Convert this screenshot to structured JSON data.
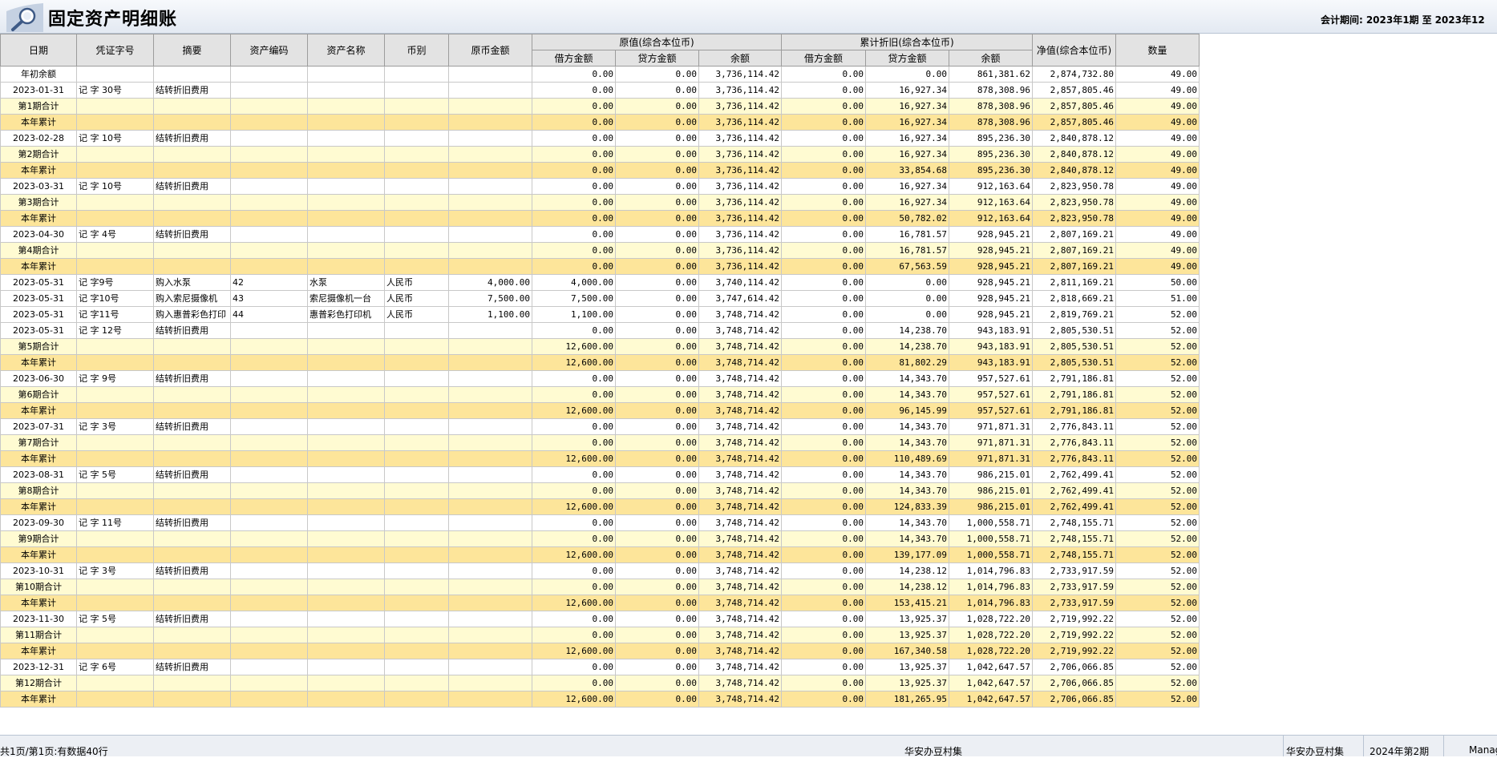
{
  "window": {
    "title": "固定资产明细账",
    "period_label": "会计期间:",
    "period_from": "2023年1期",
    "period_to_label": "至",
    "period_to": "2023年12"
  },
  "table": {
    "headers": {
      "date": "日期",
      "voucher": "凭证字号",
      "summary": "摘要",
      "asset_code": "资产编码",
      "asset_name": "资产名称",
      "currency": "币别",
      "orig_amount": "原币金额",
      "orig_value_group": "原值(综合本位币)",
      "accum_dep_group": "累计折旧(综合本位币)",
      "debit": "借方金额",
      "credit": "贷方金额",
      "balance": "余额",
      "net_value": "净值(综合本位币)",
      "quantity": "数量"
    },
    "rows": [
      {
        "type": "o",
        "date": "年初余额",
        "voucher": "",
        "summary": "",
        "code": "",
        "name": "",
        "cur": "",
        "amt": "",
        "od": "0.00",
        "oc": "0.00",
        "ob": "3,736,114.42",
        "dd": "0.00",
        "dc": "0.00",
        "db": "861,381.62",
        "nv": "2,874,732.80",
        "qty": "49.00"
      },
      {
        "type": "d",
        "date": "2023-01-31",
        "voucher": "记 字 30号",
        "summary": "结转折旧费用",
        "code": "",
        "name": "",
        "cur": "",
        "amt": "",
        "od": "0.00",
        "oc": "0.00",
        "ob": "3,736,114.42",
        "dd": "0.00",
        "dc": "16,927.34",
        "db": "878,308.96",
        "nv": "2,857,805.46",
        "qty": "49.00"
      },
      {
        "type": "s",
        "date": "第1期合计",
        "voucher": "",
        "summary": "",
        "code": "",
        "name": "",
        "cur": "",
        "amt": "",
        "od": "0.00",
        "oc": "0.00",
        "ob": "3,736,114.42",
        "dd": "0.00",
        "dc": "16,927.34",
        "db": "878,308.96",
        "nv": "2,857,805.46",
        "qty": "49.00"
      },
      {
        "type": "y",
        "date": "本年累计",
        "voucher": "",
        "summary": "",
        "code": "",
        "name": "",
        "cur": "",
        "amt": "",
        "od": "0.00",
        "oc": "0.00",
        "ob": "3,736,114.42",
        "dd": "0.00",
        "dc": "16,927.34",
        "db": "878,308.96",
        "nv": "2,857,805.46",
        "qty": "49.00"
      },
      {
        "type": "d",
        "date": "2023-02-28",
        "voucher": "记 字 10号",
        "summary": "结转折旧费用",
        "code": "",
        "name": "",
        "cur": "",
        "amt": "",
        "od": "0.00",
        "oc": "0.00",
        "ob": "3,736,114.42",
        "dd": "0.00",
        "dc": "16,927.34",
        "db": "895,236.30",
        "nv": "2,840,878.12",
        "qty": "49.00"
      },
      {
        "type": "s",
        "date": "第2期合计",
        "voucher": "",
        "summary": "",
        "code": "",
        "name": "",
        "cur": "",
        "amt": "",
        "od": "0.00",
        "oc": "0.00",
        "ob": "3,736,114.42",
        "dd": "0.00",
        "dc": "16,927.34",
        "db": "895,236.30",
        "nv": "2,840,878.12",
        "qty": "49.00"
      },
      {
        "type": "y",
        "date": "本年累计",
        "voucher": "",
        "summary": "",
        "code": "",
        "name": "",
        "cur": "",
        "amt": "",
        "od": "0.00",
        "oc": "0.00",
        "ob": "3,736,114.42",
        "dd": "0.00",
        "dc": "33,854.68",
        "db": "895,236.30",
        "nv": "2,840,878.12",
        "qty": "49.00"
      },
      {
        "type": "d",
        "date": "2023-03-31",
        "voucher": "记 字 10号",
        "summary": "结转折旧费用",
        "code": "",
        "name": "",
        "cur": "",
        "amt": "",
        "od": "0.00",
        "oc": "0.00",
        "ob": "3,736,114.42",
        "dd": "0.00",
        "dc": "16,927.34",
        "db": "912,163.64",
        "nv": "2,823,950.78",
        "qty": "49.00"
      },
      {
        "type": "s",
        "date": "第3期合计",
        "voucher": "",
        "summary": "",
        "code": "",
        "name": "",
        "cur": "",
        "amt": "",
        "od": "0.00",
        "oc": "0.00",
        "ob": "3,736,114.42",
        "dd": "0.00",
        "dc": "16,927.34",
        "db": "912,163.64",
        "nv": "2,823,950.78",
        "qty": "49.00"
      },
      {
        "type": "y",
        "date": "本年累计",
        "voucher": "",
        "summary": "",
        "code": "",
        "name": "",
        "cur": "",
        "amt": "",
        "od": "0.00",
        "oc": "0.00",
        "ob": "3,736,114.42",
        "dd": "0.00",
        "dc": "50,782.02",
        "db": "912,163.64",
        "nv": "2,823,950.78",
        "qty": "49.00"
      },
      {
        "type": "d",
        "date": "2023-04-30",
        "voucher": "记 字 4号",
        "summary": "结转折旧费用",
        "code": "",
        "name": "",
        "cur": "",
        "amt": "",
        "od": "0.00",
        "oc": "0.00",
        "ob": "3,736,114.42",
        "dd": "0.00",
        "dc": "16,781.57",
        "db": "928,945.21",
        "nv": "2,807,169.21",
        "qty": "49.00"
      },
      {
        "type": "s",
        "date": "第4期合计",
        "voucher": "",
        "summary": "",
        "code": "",
        "name": "",
        "cur": "",
        "amt": "",
        "od": "0.00",
        "oc": "0.00",
        "ob": "3,736,114.42",
        "dd": "0.00",
        "dc": "16,781.57",
        "db": "928,945.21",
        "nv": "2,807,169.21",
        "qty": "49.00"
      },
      {
        "type": "y",
        "date": "本年累计",
        "voucher": "",
        "summary": "",
        "code": "",
        "name": "",
        "cur": "",
        "amt": "",
        "od": "0.00",
        "oc": "0.00",
        "ob": "3,736,114.42",
        "dd": "0.00",
        "dc": "67,563.59",
        "db": "928,945.21",
        "nv": "2,807,169.21",
        "qty": "49.00"
      },
      {
        "type": "d",
        "date": "2023-05-31",
        "voucher": "记 字9号",
        "summary": "购入水泵",
        "code": "42",
        "name": "水泵",
        "cur": "人民币",
        "amt": "4,000.00",
        "od": "4,000.00",
        "oc": "0.00",
        "ob": "3,740,114.42",
        "dd": "0.00",
        "dc": "0.00",
        "db": "928,945.21",
        "nv": "2,811,169.21",
        "qty": "50.00"
      },
      {
        "type": "d",
        "date": "2023-05-31",
        "voucher": "记 字10号",
        "summary": "购入索尼摄像机",
        "code": "43",
        "name": "索尼摄像机一台",
        "cur": "人民币",
        "amt": "7,500.00",
        "od": "7,500.00",
        "oc": "0.00",
        "ob": "3,747,614.42",
        "dd": "0.00",
        "dc": "0.00",
        "db": "928,945.21",
        "nv": "2,818,669.21",
        "qty": "51.00"
      },
      {
        "type": "d",
        "date": "2023-05-31",
        "voucher": "记 字11号",
        "summary": "购入惠普彩色打印",
        "code": "44",
        "name": "惠普彩色打印机",
        "cur": "人民币",
        "amt": "1,100.00",
        "od": "1,100.00",
        "oc": "0.00",
        "ob": "3,748,714.42",
        "dd": "0.00",
        "dc": "0.00",
        "db": "928,945.21",
        "nv": "2,819,769.21",
        "qty": "52.00"
      },
      {
        "type": "d",
        "date": "2023-05-31",
        "voucher": "记 字 12号",
        "summary": "结转折旧费用",
        "code": "",
        "name": "",
        "cur": "",
        "amt": "",
        "od": "0.00",
        "oc": "0.00",
        "ob": "3,748,714.42",
        "dd": "0.00",
        "dc": "14,238.70",
        "db": "943,183.91",
        "nv": "2,805,530.51",
        "qty": "52.00"
      },
      {
        "type": "s",
        "date": "第5期合计",
        "voucher": "",
        "summary": "",
        "code": "",
        "name": "",
        "cur": "",
        "amt": "",
        "od": "12,600.00",
        "oc": "0.00",
        "ob": "3,748,714.42",
        "dd": "0.00",
        "dc": "14,238.70",
        "db": "943,183.91",
        "nv": "2,805,530.51",
        "qty": "52.00"
      },
      {
        "type": "y",
        "date": "本年累计",
        "voucher": "",
        "summary": "",
        "code": "",
        "name": "",
        "cur": "",
        "amt": "",
        "od": "12,600.00",
        "oc": "0.00",
        "ob": "3,748,714.42",
        "dd": "0.00",
        "dc": "81,802.29",
        "db": "943,183.91",
        "nv": "2,805,530.51",
        "qty": "52.00"
      },
      {
        "type": "d",
        "date": "2023-06-30",
        "voucher": "记 字 9号",
        "summary": "结转折旧费用",
        "code": "",
        "name": "",
        "cur": "",
        "amt": "",
        "od": "0.00",
        "oc": "0.00",
        "ob": "3,748,714.42",
        "dd": "0.00",
        "dc": "14,343.70",
        "db": "957,527.61",
        "nv": "2,791,186.81",
        "qty": "52.00"
      },
      {
        "type": "s",
        "date": "第6期合计",
        "voucher": "",
        "summary": "",
        "code": "",
        "name": "",
        "cur": "",
        "amt": "",
        "od": "0.00",
        "oc": "0.00",
        "ob": "3,748,714.42",
        "dd": "0.00",
        "dc": "14,343.70",
        "db": "957,527.61",
        "nv": "2,791,186.81",
        "qty": "52.00"
      },
      {
        "type": "y",
        "date": "本年累计",
        "voucher": "",
        "summary": "",
        "code": "",
        "name": "",
        "cur": "",
        "amt": "",
        "od": "12,600.00",
        "oc": "0.00",
        "ob": "3,748,714.42",
        "dd": "0.00",
        "dc": "96,145.99",
        "db": "957,527.61",
        "nv": "2,791,186.81",
        "qty": "52.00"
      },
      {
        "type": "d",
        "date": "2023-07-31",
        "voucher": "记 字 3号",
        "summary": "结转折旧费用",
        "code": "",
        "name": "",
        "cur": "",
        "amt": "",
        "od": "0.00",
        "oc": "0.00",
        "ob": "3,748,714.42",
        "dd": "0.00",
        "dc": "14,343.70",
        "db": "971,871.31",
        "nv": "2,776,843.11",
        "qty": "52.00"
      },
      {
        "type": "s",
        "date": "第7期合计",
        "voucher": "",
        "summary": "",
        "code": "",
        "name": "",
        "cur": "",
        "amt": "",
        "od": "0.00",
        "oc": "0.00",
        "ob": "3,748,714.42",
        "dd": "0.00",
        "dc": "14,343.70",
        "db": "971,871.31",
        "nv": "2,776,843.11",
        "qty": "52.00"
      },
      {
        "type": "y",
        "date": "本年累计",
        "voucher": "",
        "summary": "",
        "code": "",
        "name": "",
        "cur": "",
        "amt": "",
        "od": "12,600.00",
        "oc": "0.00",
        "ob": "3,748,714.42",
        "dd": "0.00",
        "dc": "110,489.69",
        "db": "971,871.31",
        "nv": "2,776,843.11",
        "qty": "52.00"
      },
      {
        "type": "d",
        "date": "2023-08-31",
        "voucher": "记 字 5号",
        "summary": "结转折旧费用",
        "code": "",
        "name": "",
        "cur": "",
        "amt": "",
        "od": "0.00",
        "oc": "0.00",
        "ob": "3,748,714.42",
        "dd": "0.00",
        "dc": "14,343.70",
        "db": "986,215.01",
        "nv": "2,762,499.41",
        "qty": "52.00"
      },
      {
        "type": "s",
        "date": "第8期合计",
        "voucher": "",
        "summary": "",
        "code": "",
        "name": "",
        "cur": "",
        "amt": "",
        "od": "0.00",
        "oc": "0.00",
        "ob": "3,748,714.42",
        "dd": "0.00",
        "dc": "14,343.70",
        "db": "986,215.01",
        "nv": "2,762,499.41",
        "qty": "52.00"
      },
      {
        "type": "y",
        "date": "本年累计",
        "voucher": "",
        "summary": "",
        "code": "",
        "name": "",
        "cur": "",
        "amt": "",
        "od": "12,600.00",
        "oc": "0.00",
        "ob": "3,748,714.42",
        "dd": "0.00",
        "dc": "124,833.39",
        "db": "986,215.01",
        "nv": "2,762,499.41",
        "qty": "52.00"
      },
      {
        "type": "d",
        "date": "2023-09-30",
        "voucher": "记 字 11号",
        "summary": "结转折旧费用",
        "code": "",
        "name": "",
        "cur": "",
        "amt": "",
        "od": "0.00",
        "oc": "0.00",
        "ob": "3,748,714.42",
        "dd": "0.00",
        "dc": "14,343.70",
        "db": "1,000,558.71",
        "nv": "2,748,155.71",
        "qty": "52.00"
      },
      {
        "type": "s",
        "date": "第9期合计",
        "voucher": "",
        "summary": "",
        "code": "",
        "name": "",
        "cur": "",
        "amt": "",
        "od": "0.00",
        "oc": "0.00",
        "ob": "3,748,714.42",
        "dd": "0.00",
        "dc": "14,343.70",
        "db": "1,000,558.71",
        "nv": "2,748,155.71",
        "qty": "52.00"
      },
      {
        "type": "y",
        "date": "本年累计",
        "voucher": "",
        "summary": "",
        "code": "",
        "name": "",
        "cur": "",
        "amt": "",
        "od": "12,600.00",
        "oc": "0.00",
        "ob": "3,748,714.42",
        "dd": "0.00",
        "dc": "139,177.09",
        "db": "1,000,558.71",
        "nv": "2,748,155.71",
        "qty": "52.00"
      },
      {
        "type": "d",
        "date": "2023-10-31",
        "voucher": "记 字 3号",
        "summary": "结转折旧费用",
        "code": "",
        "name": "",
        "cur": "",
        "amt": "",
        "od": "0.00",
        "oc": "0.00",
        "ob": "3,748,714.42",
        "dd": "0.00",
        "dc": "14,238.12",
        "db": "1,014,796.83",
        "nv": "2,733,917.59",
        "qty": "52.00"
      },
      {
        "type": "s",
        "date": "第10期合计",
        "voucher": "",
        "summary": "",
        "code": "",
        "name": "",
        "cur": "",
        "amt": "",
        "od": "0.00",
        "oc": "0.00",
        "ob": "3,748,714.42",
        "dd": "0.00",
        "dc": "14,238.12",
        "db": "1,014,796.83",
        "nv": "2,733,917.59",
        "qty": "52.00"
      },
      {
        "type": "y",
        "date": "本年累计",
        "voucher": "",
        "summary": "",
        "code": "",
        "name": "",
        "cur": "",
        "amt": "",
        "od": "12,600.00",
        "oc": "0.00",
        "ob": "3,748,714.42",
        "dd": "0.00",
        "dc": "153,415.21",
        "db": "1,014,796.83",
        "nv": "2,733,917.59",
        "qty": "52.00"
      },
      {
        "type": "d",
        "date": "2023-11-30",
        "voucher": "记 字 5号",
        "summary": "结转折旧费用",
        "code": "",
        "name": "",
        "cur": "",
        "amt": "",
        "od": "0.00",
        "oc": "0.00",
        "ob": "3,748,714.42",
        "dd": "0.00",
        "dc": "13,925.37",
        "db": "1,028,722.20",
        "nv": "2,719,992.22",
        "qty": "52.00"
      },
      {
        "type": "s",
        "date": "第11期合计",
        "voucher": "",
        "summary": "",
        "code": "",
        "name": "",
        "cur": "",
        "amt": "",
        "od": "0.00",
        "oc": "0.00",
        "ob": "3,748,714.42",
        "dd": "0.00",
        "dc": "13,925.37",
        "db": "1,028,722.20",
        "nv": "2,719,992.22",
        "qty": "52.00"
      },
      {
        "type": "y",
        "date": "本年累计",
        "voucher": "",
        "summary": "",
        "code": "",
        "name": "",
        "cur": "",
        "amt": "",
        "od": "12,600.00",
        "oc": "0.00",
        "ob": "3,748,714.42",
        "dd": "0.00",
        "dc": "167,340.58",
        "db": "1,028,722.20",
        "nv": "2,719,992.22",
        "qty": "52.00"
      },
      {
        "type": "d",
        "date": "2023-12-31",
        "voucher": "记 字 6号",
        "summary": "结转折旧费用",
        "code": "",
        "name": "",
        "cur": "",
        "amt": "",
        "od": "0.00",
        "oc": "0.00",
        "ob": "3,748,714.42",
        "dd": "0.00",
        "dc": "13,925.37",
        "db": "1,042,647.57",
        "nv": "2,706,066.85",
        "qty": "52.00"
      },
      {
        "type": "s",
        "date": "第12期合计",
        "voucher": "",
        "summary": "",
        "code": "",
        "name": "",
        "cur": "",
        "amt": "",
        "od": "0.00",
        "oc": "0.00",
        "ob": "3,748,714.42",
        "dd": "0.00",
        "dc": "13,925.37",
        "db": "1,042,647.57",
        "nv": "2,706,066.85",
        "qty": "52.00"
      },
      {
        "type": "y",
        "date": "本年累计",
        "voucher": "",
        "summary": "",
        "code": "",
        "name": "",
        "cur": "",
        "amt": "",
        "od": "12,600.00",
        "oc": "0.00",
        "ob": "3,748,714.42",
        "dd": "0.00",
        "dc": "181,265.95",
        "db": "1,042,647.57",
        "nv": "2,706,066.85",
        "qty": "52.00"
      }
    ]
  },
  "statusbar": {
    "page_info": "共1页/第1页:有数据40行",
    "company_center": "华安办豆村集",
    "company_right": "华安办豆村集",
    "period": "2024年第2期",
    "user": "Manage"
  },
  "colors": {
    "subtotal_row": "#fffbd2",
    "year_total_row": "#fde59a",
    "header_bg": "#e3e3e3"
  }
}
